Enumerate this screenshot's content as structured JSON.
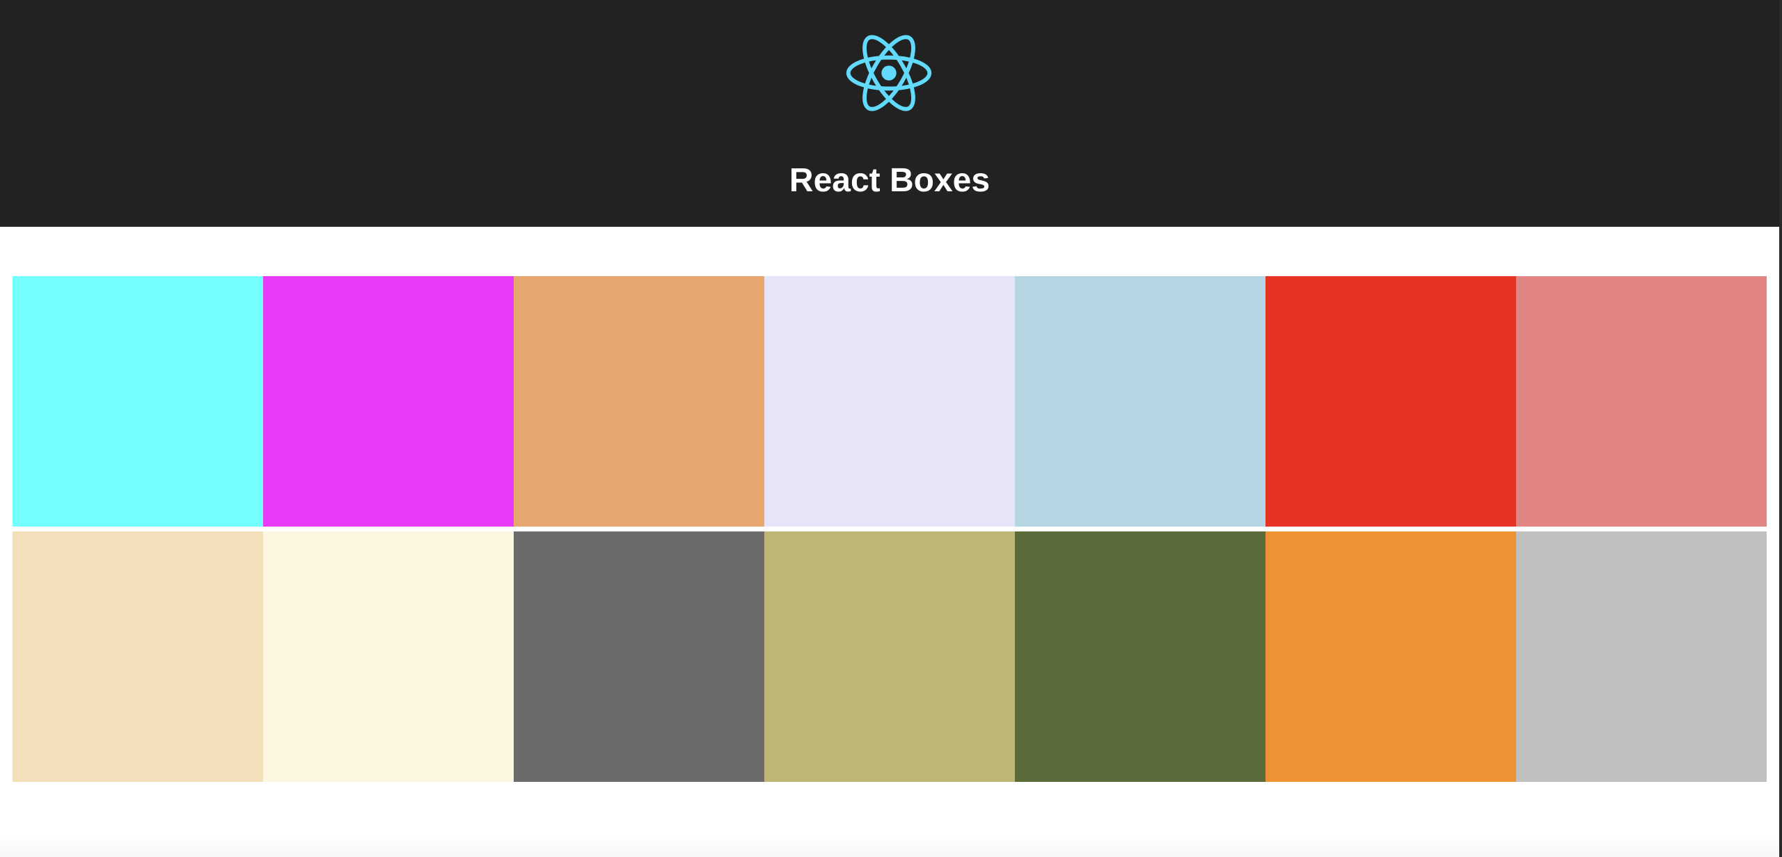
{
  "header": {
    "logo_icon": "react-atom-logo-icon",
    "logo_color": "#61DAFB",
    "title": "React Boxes",
    "background": "#222222"
  },
  "boxes": [
    {
      "color": "#74FFFF"
    },
    {
      "color": "#E93AF7"
    },
    {
      "color": "#E8A76F"
    },
    {
      "color": "#E6E5F7"
    },
    {
      "color": "#B5D7E3"
    },
    {
      "color": "#E83323"
    },
    {
      "color": "#E08583"
    },
    {
      "color": "#F3DFBA"
    },
    {
      "color": "#FDF6E0"
    },
    {
      "color": "#6B6B6B"
    },
    {
      "color": "#BDB677"
    },
    {
      "color": "#5B6C3A"
    },
    {
      "color": "#EF9135"
    },
    {
      "color": "#BFBFBF"
    }
  ]
}
